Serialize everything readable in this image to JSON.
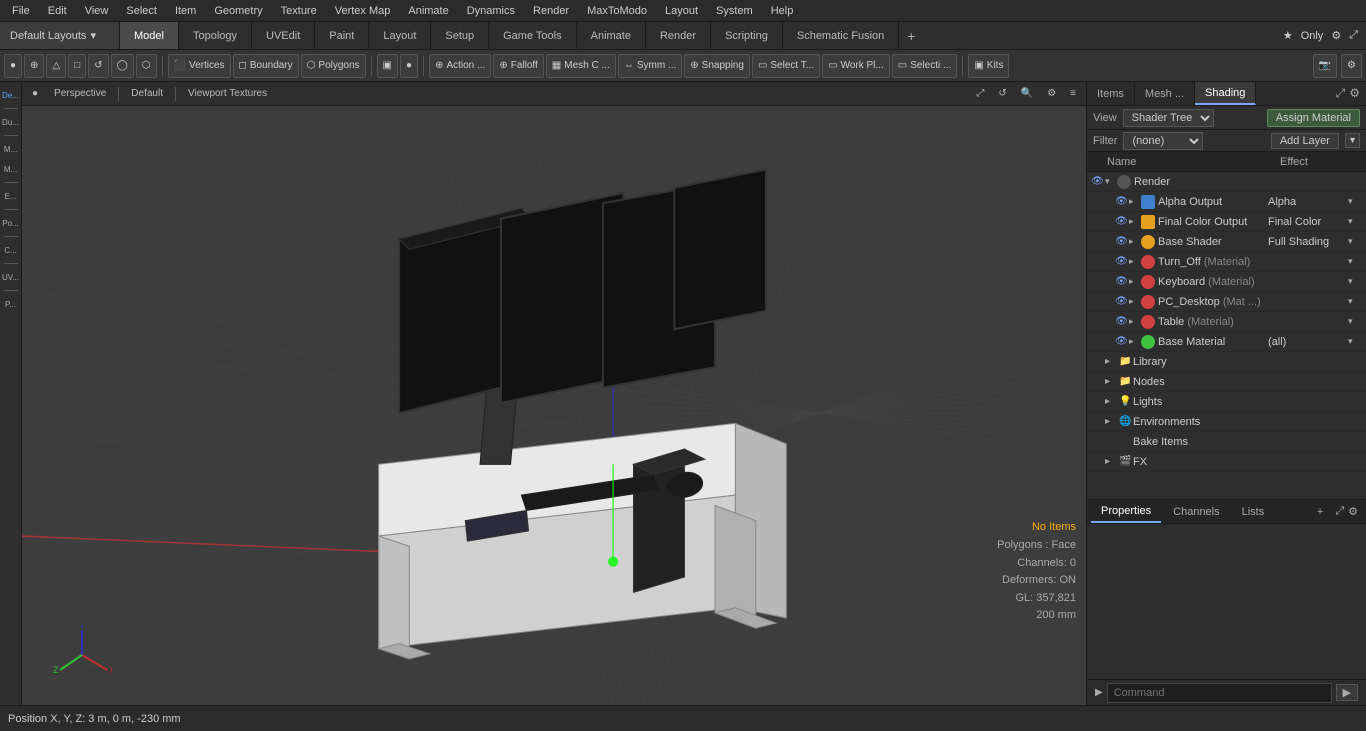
{
  "menubar": {
    "items": [
      "File",
      "Edit",
      "View",
      "Select",
      "Item",
      "Geometry",
      "Texture",
      "Vertex Map",
      "Animate",
      "Dynamics",
      "Render",
      "MaxToModo",
      "Layout",
      "System",
      "Help"
    ]
  },
  "layout_bar": {
    "dropdown_label": "Default Layouts",
    "tabs": [
      "Model",
      "Topology",
      "UVEdit",
      "Paint",
      "Layout",
      "Setup",
      "Game Tools",
      "Animate",
      "Render",
      "Scripting",
      "Schematic Fusion"
    ],
    "active_tab": "Model",
    "plus_label": "+",
    "star_label": "★ Only"
  },
  "toolbar": {
    "buttons": [
      {
        "label": "●",
        "text": ""
      },
      {
        "label": "⊕",
        "text": ""
      },
      {
        "label": "△",
        "text": ""
      },
      {
        "label": "□",
        "text": ""
      },
      {
        "label": "↺",
        "text": ""
      },
      {
        "label": "◯",
        "text": ""
      },
      {
        "label": "⬡",
        "text": ""
      },
      {
        "label": "Vertices",
        "text": "Vertices"
      },
      {
        "label": "Boundary",
        "text": "Boundary"
      },
      {
        "label": "Polygons",
        "text": "Polygons"
      },
      {
        "label": "▣",
        "text": ""
      },
      {
        "label": "●",
        "text": ""
      },
      {
        "label": "⊕ Action ...",
        "text": "Action ..."
      },
      {
        "label": "⊕ Falloff",
        "text": "Falloff"
      },
      {
        "label": "Mesh C ...",
        "text": "Mesh C ..."
      },
      {
        "label": "Symm ...",
        "text": "Symm ..."
      },
      {
        "label": "⊕ Snapping",
        "text": "Snapping"
      },
      {
        "label": "Select T...",
        "text": "Select T..."
      },
      {
        "label": "Work Pl...",
        "text": "Work Pl..."
      },
      {
        "label": "Selecti ...",
        "text": "Selecti ..."
      },
      {
        "label": "Kits",
        "text": "Kits"
      }
    ]
  },
  "viewport": {
    "label": "Perspective",
    "shading": "Default",
    "texture": "Viewport Textures",
    "status": {
      "no_items": "No Items",
      "polygons": "Polygons : Face",
      "channels": "Channels: 0",
      "deformers": "Deformers: ON",
      "gl": "GL: 357,821",
      "size": "200 mm"
    },
    "position": "Position X, Y, Z:  3 m, 0 m, -230 mm"
  },
  "right_panel": {
    "tabs": [
      "Items",
      "Mesh ...",
      "Shading"
    ],
    "active_tab": "Shading",
    "view_label": "View",
    "view_option": "Shader Tree",
    "assign_material": "Assign Material",
    "filter_label": "Filter",
    "filter_option": "(none)",
    "add_layer": "Add Layer",
    "tree_headers": {
      "name": "Name",
      "effect": "Effect"
    },
    "tree_items": [
      {
        "level": 1,
        "expanded": true,
        "icon": "none",
        "icon_color": "none",
        "name": "Render",
        "effect": ""
      },
      {
        "level": 2,
        "expanded": false,
        "icon": "sq-blue",
        "name": "Alpha Output",
        "effect": "Alpha"
      },
      {
        "level": 2,
        "expanded": false,
        "icon": "sq-orange",
        "name": "Final Color Output",
        "effect": "Final Color"
      },
      {
        "level": 2,
        "expanded": false,
        "icon": "orange",
        "name": "Base Shader",
        "effect": "Full Shading"
      },
      {
        "level": 2,
        "expanded": false,
        "icon": "red",
        "name": "Turn_Off",
        "extra": "(Material)",
        "effect": ""
      },
      {
        "level": 2,
        "expanded": false,
        "icon": "red",
        "name": "Keyboard",
        "extra": "(Material)",
        "effect": ""
      },
      {
        "level": 2,
        "expanded": false,
        "icon": "red",
        "name": "PC_Desktop",
        "extra": "(Mat ...)",
        "effect": ""
      },
      {
        "level": 2,
        "expanded": false,
        "icon": "red",
        "name": "Table",
        "extra": "(Material)",
        "effect": ""
      },
      {
        "level": 2,
        "expanded": false,
        "icon": "green",
        "name": "Base Material",
        "extra": "",
        "effect": "(all)"
      },
      {
        "level": 1,
        "expanded": false,
        "icon": "none",
        "name": "Library",
        "effect": ""
      },
      {
        "level": 1,
        "expanded": false,
        "icon": "none",
        "name": "Nodes",
        "effect": ""
      },
      {
        "level": 1,
        "expanded": false,
        "icon": "none",
        "name": "Lights",
        "effect": ""
      },
      {
        "level": 1,
        "expanded": false,
        "icon": "none",
        "name": "Environments",
        "effect": ""
      },
      {
        "level": 1,
        "expanded": false,
        "icon": "none",
        "name": "Bake Items",
        "effect": ""
      },
      {
        "level": 1,
        "expanded": false,
        "icon": "film",
        "name": "FX",
        "effect": ""
      }
    ]
  },
  "properties_panel": {
    "tabs": [
      "Properties",
      "Channels",
      "Lists"
    ],
    "active_tab": "Properties"
  },
  "command_bar": {
    "placeholder": "Command",
    "arrow": "▶"
  }
}
